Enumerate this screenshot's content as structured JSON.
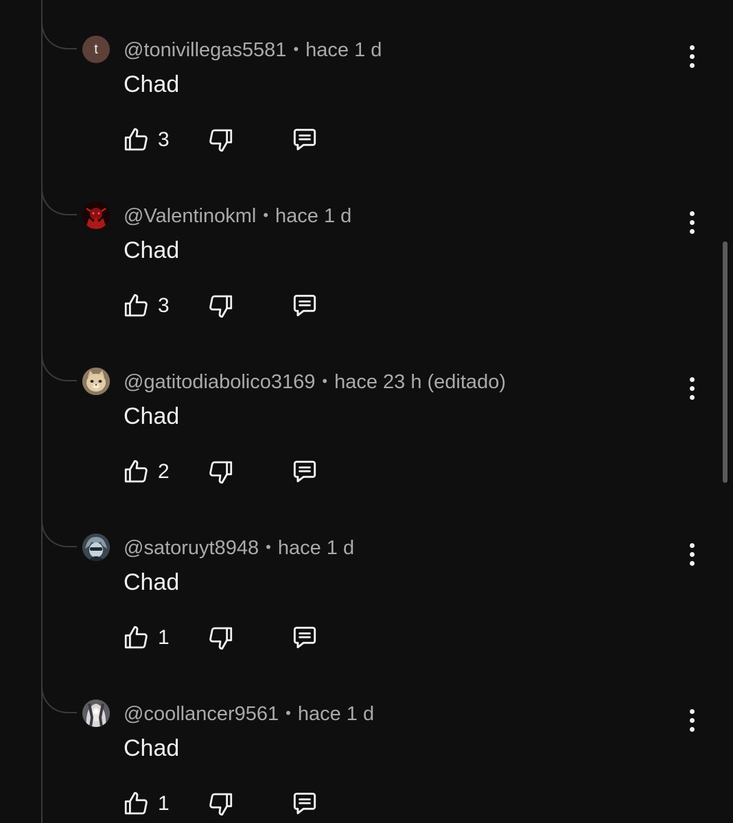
{
  "comments": [
    {
      "handle": "@tonivillegas5581",
      "separator": "•",
      "time": "hace 1 d",
      "text": "Chad",
      "likes": "3",
      "avatar": {
        "type": "letter",
        "letter": "t",
        "color": "#5d4037",
        "icon": "letter-t-avatar"
      }
    },
    {
      "handle": "@Valentinokml",
      "separator": "•",
      "time": "hace 1 d",
      "text": "Chad",
      "likes": "3",
      "avatar": {
        "type": "image",
        "color": "#7a0f0f",
        "icon": "red-anime-avatar"
      }
    },
    {
      "handle": "@gatitodiabolico3169",
      "separator": "•",
      "time": "hace 23 h (editado)",
      "text": "Chad",
      "likes": "2",
      "avatar": {
        "type": "image",
        "color": "#c9b08a",
        "icon": "cat-avatar"
      }
    },
    {
      "handle": "@satoruyt8948",
      "separator": "•",
      "time": "hace 1 d",
      "text": "Chad",
      "likes": "1",
      "avatar": {
        "type": "image",
        "color": "#4a5a66",
        "icon": "anime-character-avatar"
      }
    },
    {
      "handle": "@coollancer9561",
      "separator": "•",
      "time": "hace 1 d",
      "text": "Chad",
      "likes": "1",
      "avatar": {
        "type": "image",
        "color": "#8a8a8a",
        "icon": "anime-character-avatar"
      }
    }
  ],
  "colors": {
    "background": "#0f0f0f",
    "text_primary": "#f1f1f1",
    "text_secondary": "#aaaaaa",
    "thread_line": "#3a3a3a"
  }
}
